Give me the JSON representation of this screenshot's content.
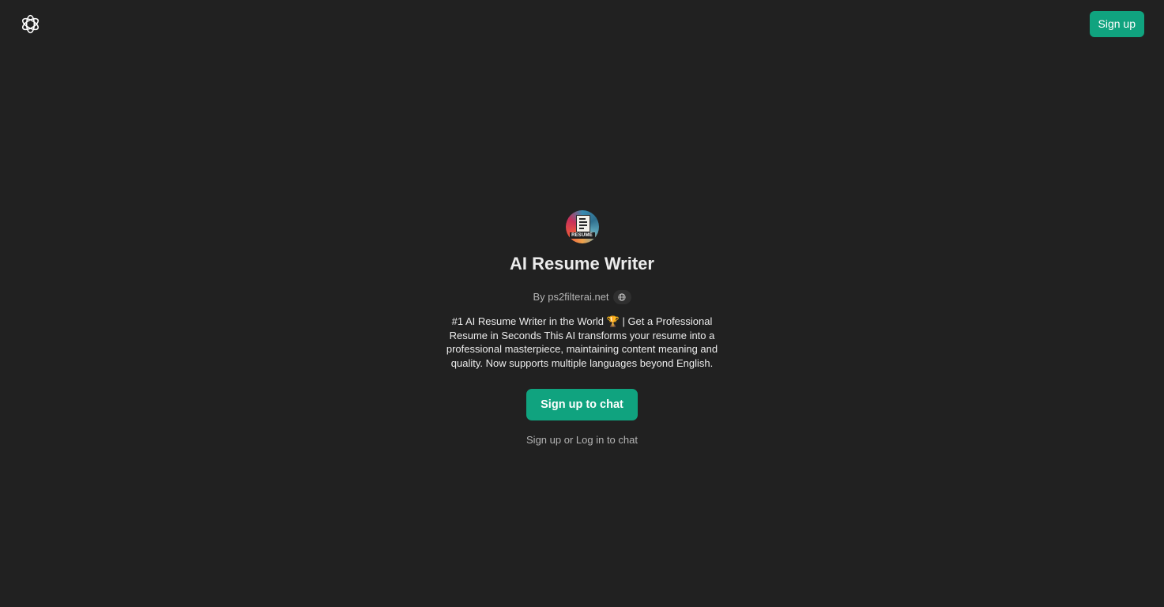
{
  "header": {
    "logo_icon": "openai-logo-icon",
    "signup_label": "Sign up"
  },
  "gpt": {
    "avatar_icon": "resume-avatar-icon",
    "avatar_text": "RESUME",
    "name": "AI Resume Writer",
    "byline": "By ps2filterai.net",
    "website_icon": "globe-icon",
    "description": "#1 AI Resume Writer in the World 🏆 | Get a Professional Resume in Seconds This AI transforms your resume into a professional masterpiece, maintaining content meaning and quality. Now supports multiple languages beyond English."
  },
  "actions": {
    "primary_label": "Sign up to chat",
    "signup_link": "Sign up",
    "separator": " or ",
    "login_link": "Log in",
    "suffix": " to chat"
  },
  "colors": {
    "background": "#212121",
    "accent": "#10a37f",
    "text": "#ececec",
    "muted_text": "#b4b4b4"
  }
}
